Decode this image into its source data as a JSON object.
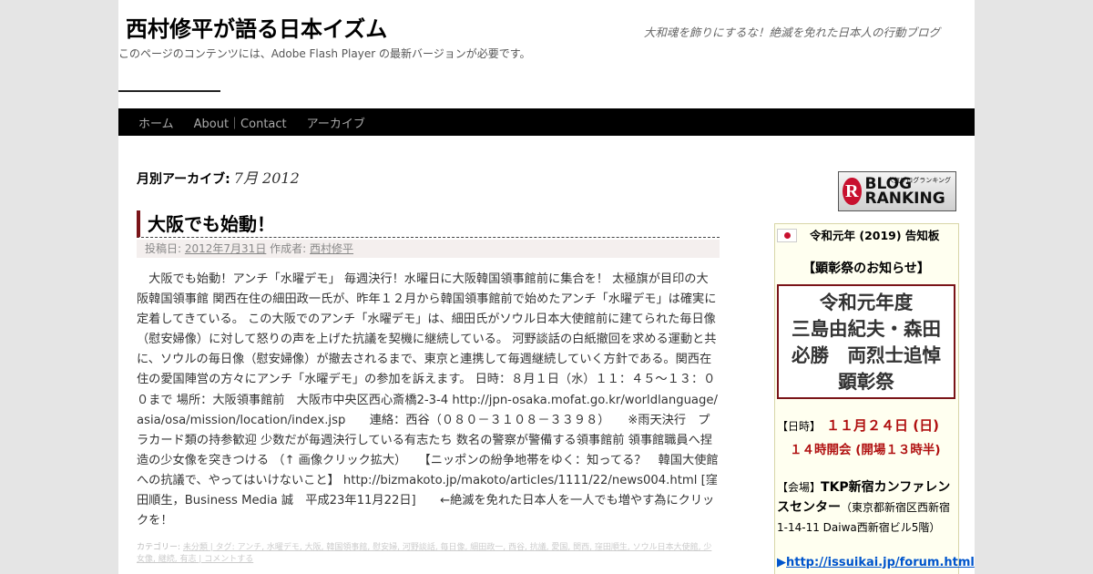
{
  "header": {
    "title": "西村修平が語る日本イズム",
    "flash_note": "このページのコンテンツには、Adobe Flash Player の最新バージョンが必要です。",
    "tagline": "大和魂を飾りにするな！絶滅を免れた日本人の行動ブログ"
  },
  "nav": {
    "items": [
      {
        "label": "ホーム"
      },
      {
        "label": "About｜Contact"
      },
      {
        "label": "アーカイブ"
      }
    ]
  },
  "archive": {
    "label": "月別アーカイブ:",
    "date": "7月 2012"
  },
  "post": {
    "title": "大阪でも始動！",
    "meta": {
      "posted_prefix": "投稿日:",
      "date": "2012年7月31日",
      "author_prefix": "作成者:",
      "author": "西村修平"
    },
    "body": "　大阪でも始動！アンチ「水曜デモ」 毎週決行！水曜日に大阪韓国領事館前に集合を！ 太極旗が目印の大阪韓国領事館 関西在住の細田政一氏が、昨年１２月から韓国領事館前で始めたアンチ「水曜デモ」は確実に定着してきている。 この大阪でのアンチ「水曜デモ」は、細田氏がソウル日本大使館前に建てられた毎日像（慰安婦像）に対して怒りの声を上げた抗議を契機に継続している。 河野談話の白紙撤回を求める運動と共に、ソウルの毎日像（慰安婦像）が撤去されるまで、東京と連携して毎週継続していく方針である。関西在住の愛国陣営の方々にアンチ「水曜デモ」の参加を訴えます。 日時：８月１日（水）１１：４５～１３：００まで 場所：大阪領事館前　大阪市中央区西心斎橋2-3-4 http://jpn-osaka.mofat.go.kr/worldlanguage/asia/osa/mission/location/index.jsp　　連絡：西谷（０８０－３１０８－３３９８）　　※雨天決行　プラカード類の持参歓迎 少数だが毎週決行している有志たち 数名の警察が警備する領事館前 領事館職員へ捏造の少女像を突きつける （↑ 画像クリック拡大）　　【ニッポンの紛争地帯をゆく：知ってる？　韓国大使館への抗議で、やってはいけないこと】 http://bizmakoto.jp/makoto/articles/1111/22/news004.html [窪田順生，Business Media 誠　平成23年11月22日]　　←絶滅を免れた日本人を一人でも増やす為にクリックを！",
    "footer_label": "カテゴリー:",
    "footer_links": "未分類 | タグ: アンチ, 水曜デモ, 大阪, 韓国領事館, 慰安婦, 河野談話, 毎日像, 細田政一, 西谷, 抗議, 愛国, 関西, 窪田順生, ソウル日本大使館, 少女像, 継続, 有志 | コメントする"
  },
  "sidebar": {
    "blog_ranking": {
      "logo_letter": "R",
      "text": "BLOG RANKING",
      "small": "人気ブログランキング"
    },
    "notice": {
      "title": "令和元年 (2019) 告知板",
      "heading": "【顕彰祭のお知らせ】",
      "event_lines": [
        "令和元年度",
        "三島由紀夫・森田",
        "必勝　両烈士追悼",
        "顕彰祭"
      ],
      "date_label": "【日時】",
      "date_value": "１１月２４日 (日)",
      "time_value": "１４時開会 (開場１３時半)",
      "venue_label": "【会場】",
      "venue_name": "TKP新宿カンファレンスセンター",
      "venue_address": "（東京都新宿区西新宿1-14-11 Daiwa西新宿ビル5階）",
      "link_arrow": "▶",
      "link": "http://issuikai.jp/forum.html"
    }
  },
  "colors": {
    "nav_bg": "#000000",
    "accent": "#7a1418",
    "link_blue": "#0055cc",
    "date_red": "#b01010"
  }
}
